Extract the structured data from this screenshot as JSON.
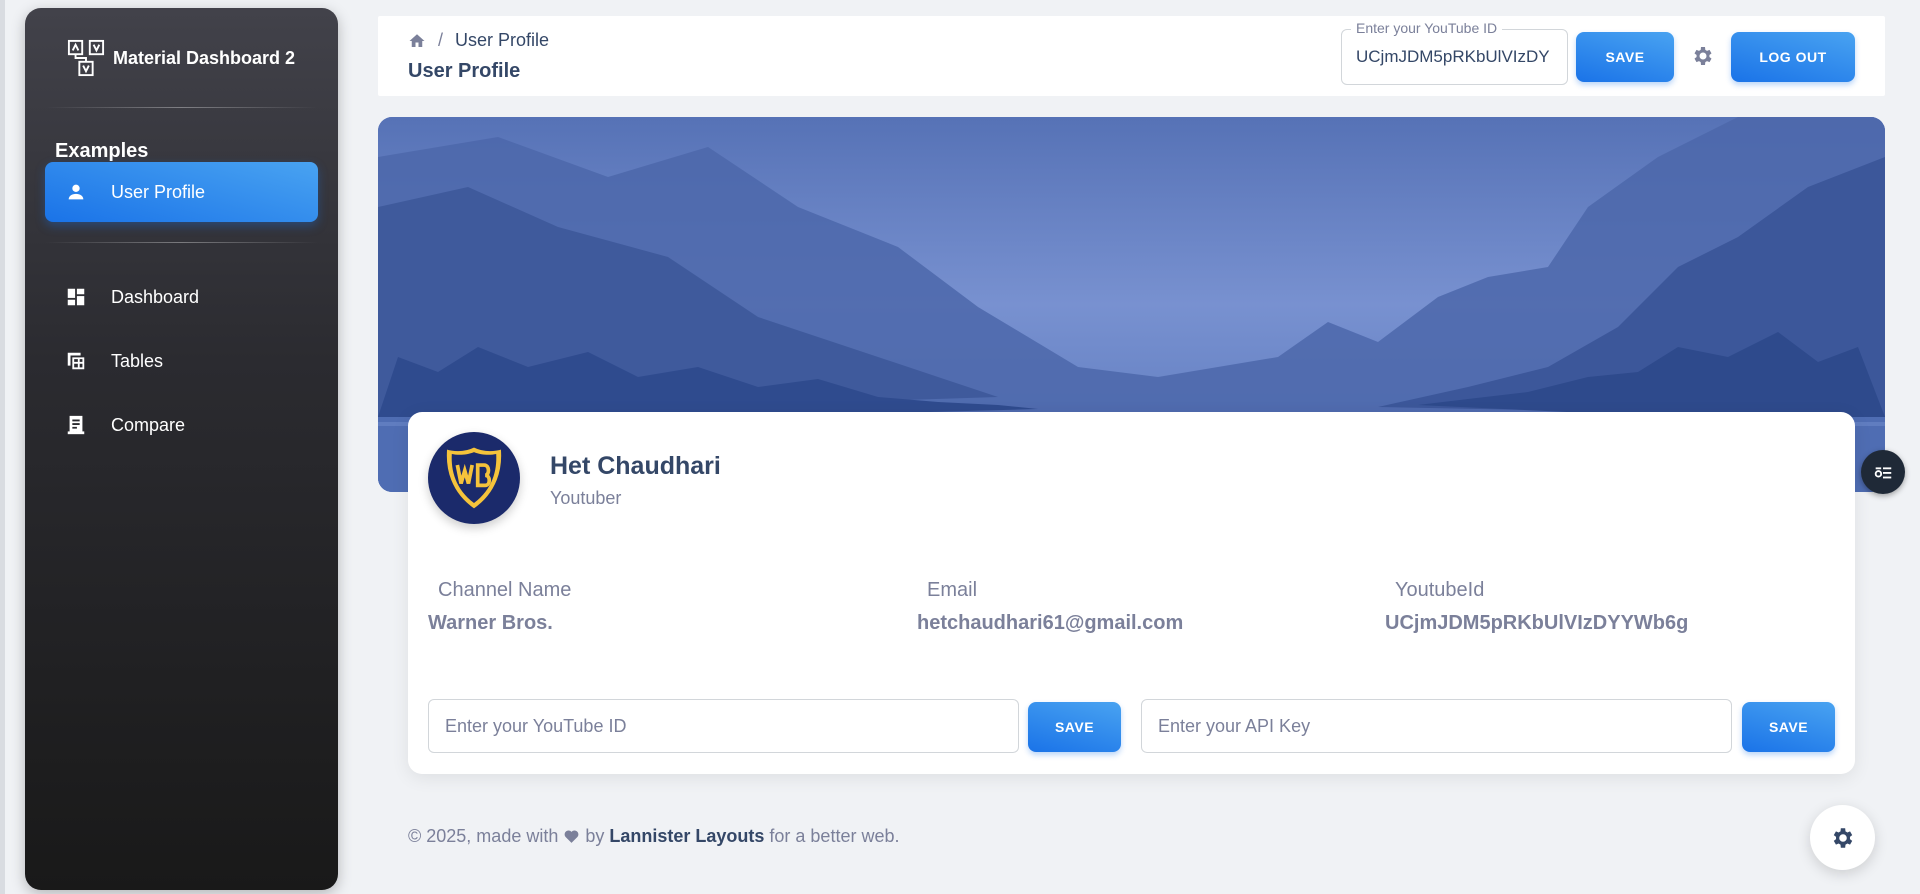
{
  "sidebar": {
    "brand": "Material Dashboard 2",
    "section_title": "Examples",
    "active_item": "User Profile",
    "items": [
      {
        "label": "Dashboard",
        "icon": "dashboard-icon"
      },
      {
        "label": "Tables",
        "icon": "table-icon"
      },
      {
        "label": "Compare",
        "icon": "receipt-icon"
      }
    ]
  },
  "topbar": {
    "breadcrumb": "User Profile",
    "title": "User Profile",
    "youtube_label": "Enter your YouTube ID",
    "youtube_value": "UCjmJDM5pRKbUlVIzDY",
    "save_label": "SAVE",
    "logout_label": "LOG OUT"
  },
  "profile": {
    "name": "Het Chaudhari",
    "role": "Youtuber",
    "fields": [
      {
        "label": "Channel Name",
        "value": "Warner Bros."
      },
      {
        "label": "Email",
        "value": "hetchaudhari61@gmail.com"
      },
      {
        "label": "YoutubeId",
        "value": "UCjmJDM5pRKbUlVIzDYYWb6g"
      }
    ],
    "youtube_placeholder": "Enter your YouTube ID",
    "api_placeholder": "Enter your API Key",
    "save_label": "SAVE"
  },
  "footer": {
    "prefix": "© 2025, made with",
    "by": "by",
    "author": "Lannister Layouts",
    "suffix": "for a better web."
  },
  "colors": {
    "primary": "#1a73e8",
    "sidebar_dark": "#191919",
    "text": "#344767",
    "muted": "#7b809a"
  }
}
